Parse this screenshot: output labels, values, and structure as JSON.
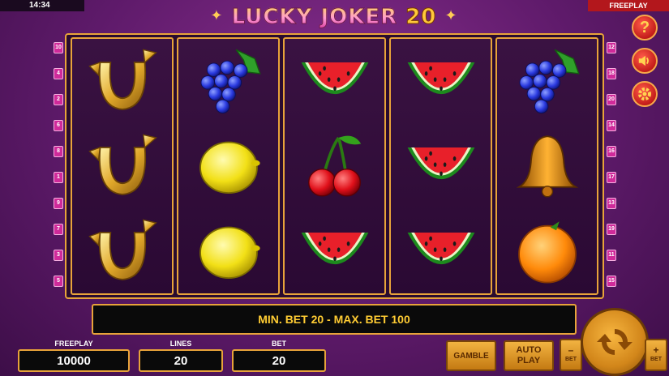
{
  "status_bar": {
    "clock": "14:34",
    "mode": "FREEPLAY"
  },
  "logo": {
    "main": "LUCKY JOKER",
    "number": "20"
  },
  "paylines": {
    "left": [
      "10",
      "4",
      "2",
      "6",
      "8",
      "1",
      "9",
      "7",
      "3",
      "5"
    ],
    "right": [
      "12",
      "18",
      "20",
      "14",
      "16",
      "17",
      "13",
      "19",
      "11",
      "15"
    ]
  },
  "reels": [
    [
      "horseshoe",
      "horseshoe",
      "horseshoe"
    ],
    [
      "grapes",
      "lemon",
      "lemon"
    ],
    [
      "watermelon",
      "cherries",
      "watermelon"
    ],
    [
      "watermelon",
      "watermelon",
      "watermelon"
    ],
    [
      "grapes",
      "bell",
      "orange"
    ]
  ],
  "side_buttons": {
    "help": "?",
    "sound": "sound-icon",
    "settings": "gear-icon"
  },
  "message": "MIN. BET 20 - MAX. BET 100",
  "stats": {
    "freeplay": {
      "label": "FREEPLAY",
      "value": "10000"
    },
    "lines": {
      "label": "LINES",
      "value": "20"
    },
    "bet": {
      "label": "BET",
      "value": "20"
    }
  },
  "buttons": {
    "gamble": "GAMBLE",
    "auto_line1": "AUTO",
    "auto_line2": "PLAY",
    "bet_minus": "–",
    "bet_minus_label": "BET",
    "bet_plus": "+",
    "bet_plus_label": "BET"
  },
  "colors": {
    "frame": "#e8a33a",
    "accent": "#ffcc33",
    "badge": "#b3171c"
  }
}
